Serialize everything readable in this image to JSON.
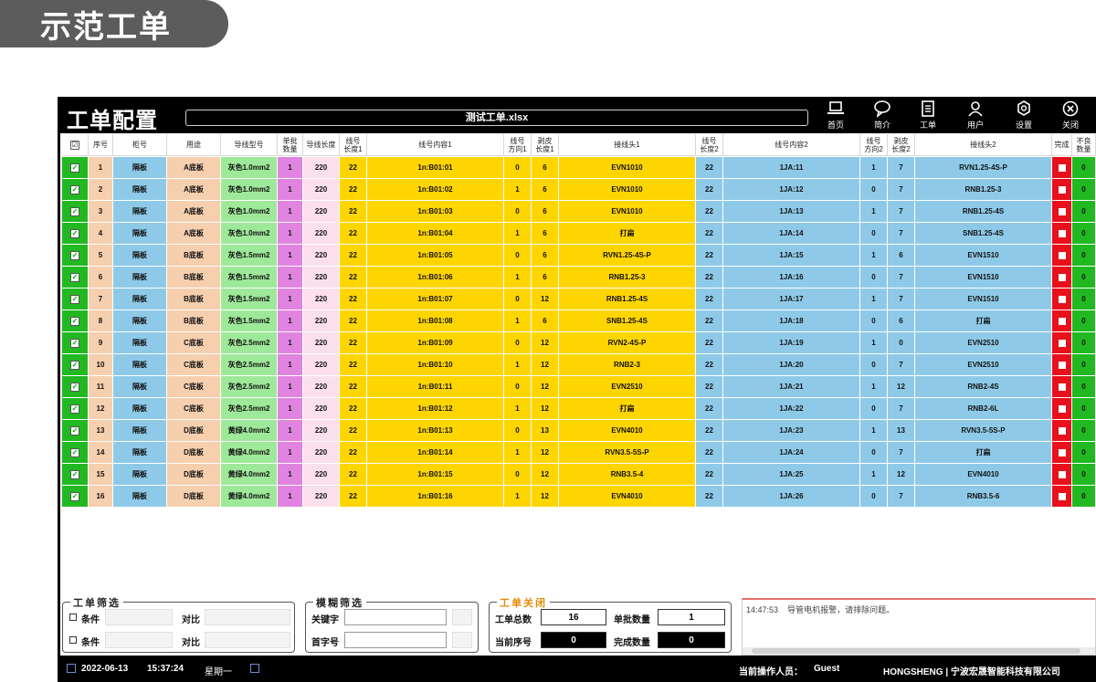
{
  "banner": "示范工单",
  "window": {
    "title": "工单配置",
    "filename": "测试工单.xlsx",
    "nav": [
      {
        "label": "首页",
        "icon": "laptop-icon"
      },
      {
        "label": "简介",
        "icon": "chat-bubble-icon"
      },
      {
        "label": "工单",
        "icon": "document-icon"
      },
      {
        "label": "用户",
        "icon": "user-icon"
      },
      {
        "label": "设置",
        "icon": "gear-icon"
      },
      {
        "label": "关闭",
        "icon": "close-icon"
      }
    ]
  },
  "table": {
    "headers": [
      "☑",
      "序号",
      "柜号",
      "用途",
      "导线型号",
      "单批\n数量",
      "导线长度",
      "线号\n长度1",
      "线号内容1",
      "线号\n方向1",
      "剥皮\n长度1",
      "接线头1",
      "线号\n长度2",
      "线号内容2",
      "线号\n方向2",
      "剥皮\n长度2",
      "接线头2",
      "完成",
      "不良\n数量"
    ],
    "colors": {
      "check": "#22b822",
      "seq": "#f6cfae",
      "cabinet": "#8ecae8",
      "use": "#f6cfae",
      "wire": "#9ee89a",
      "batch": "#e084e0",
      "length": "#fbe0ec",
      "yellow": "#ffd500",
      "blue": "#8ecae8",
      "done": "#e8101a",
      "bad": "#22b822"
    },
    "rows": [
      {
        "seq": "1",
        "cabinet": "隔板",
        "use": "A底板",
        "wire": "灰色1.0mm2",
        "batch": "1",
        "length": "220",
        "len1": "22",
        "content1": "1n:B01:01",
        "dir1": "0",
        "strip1": "6",
        "term1": "EVN1010",
        "len2": "22",
        "content2": "1JA:11",
        "dir2": "1",
        "strip2": "7",
        "term2": "RVN1.25-4S-P",
        "bad": "0"
      },
      {
        "seq": "2",
        "cabinet": "隔板",
        "use": "A底板",
        "wire": "灰色1.0mm2",
        "batch": "1",
        "length": "220",
        "len1": "22",
        "content1": "1n:B01:02",
        "dir1": "1",
        "strip1": "6",
        "term1": "EVN1010",
        "len2": "22",
        "content2": "1JA:12",
        "dir2": "0",
        "strip2": "7",
        "term2": "RNB1.25-3",
        "bad": "0"
      },
      {
        "seq": "3",
        "cabinet": "隔板",
        "use": "A底板",
        "wire": "灰色1.0mm2",
        "batch": "1",
        "length": "220",
        "len1": "22",
        "content1": "1n:B01:03",
        "dir1": "0",
        "strip1": "6",
        "term1": "EVN1010",
        "len2": "22",
        "content2": "1JA:13",
        "dir2": "1",
        "strip2": "7",
        "term2": "RNB1.25-4S",
        "bad": "0"
      },
      {
        "seq": "4",
        "cabinet": "隔板",
        "use": "A底板",
        "wire": "灰色1.0mm2",
        "batch": "1",
        "length": "220",
        "len1": "22",
        "content1": "1n:B01:04",
        "dir1": "1",
        "strip1": "6",
        "term1": "打扁",
        "len2": "22",
        "content2": "1JA:14",
        "dir2": "0",
        "strip2": "7",
        "term2": "SNB1.25-4S",
        "bad": "0"
      },
      {
        "seq": "5",
        "cabinet": "隔板",
        "use": "B底板",
        "wire": "灰色1.5mm2",
        "batch": "1",
        "length": "220",
        "len1": "22",
        "content1": "1n:B01:05",
        "dir1": "0",
        "strip1": "6",
        "term1": "RVN1.25-4S-P",
        "len2": "22",
        "content2": "1JA:15",
        "dir2": "1",
        "strip2": "6",
        "term2": "EVN1510",
        "bad": "0"
      },
      {
        "seq": "6",
        "cabinet": "隔板",
        "use": "B底板",
        "wire": "灰色1.5mm2",
        "batch": "1",
        "length": "220",
        "len1": "22",
        "content1": "1n:B01:06",
        "dir1": "1",
        "strip1": "6",
        "term1": "RNB1.25-3",
        "len2": "22",
        "content2": "1JA:16",
        "dir2": "0",
        "strip2": "7",
        "term2": "EVN1510",
        "bad": "0"
      },
      {
        "seq": "7",
        "cabinet": "隔板",
        "use": "B底板",
        "wire": "灰色1.5mm2",
        "batch": "1",
        "length": "220",
        "len1": "22",
        "content1": "1n:B01:07",
        "dir1": "0",
        "strip1": "12",
        "term1": "RNB1.25-4S",
        "len2": "22",
        "content2": "1JA:17",
        "dir2": "1",
        "strip2": "7",
        "term2": "EVN1510",
        "bad": "0"
      },
      {
        "seq": "8",
        "cabinet": "隔板",
        "use": "B底板",
        "wire": "灰色1.5mm2",
        "batch": "1",
        "length": "220",
        "len1": "22",
        "content1": "1n:B01:08",
        "dir1": "1",
        "strip1": "6",
        "term1": "SNB1.25-4S",
        "len2": "22",
        "content2": "1JA:18",
        "dir2": "0",
        "strip2": "6",
        "term2": "打扁",
        "bad": "0"
      },
      {
        "seq": "9",
        "cabinet": "隔板",
        "use": "C底板",
        "wire": "灰色2.5mm2",
        "batch": "1",
        "length": "220",
        "len1": "22",
        "content1": "1n:B01:09",
        "dir1": "0",
        "strip1": "12",
        "term1": "RVN2-4S-P",
        "len2": "22",
        "content2": "1JA:19",
        "dir2": "1",
        "strip2": "0",
        "term2": "EVN2510",
        "bad": "0"
      },
      {
        "seq": "10",
        "cabinet": "隔板",
        "use": "C底板",
        "wire": "灰色2.5mm2",
        "batch": "1",
        "length": "220",
        "len1": "22",
        "content1": "1n:B01:10",
        "dir1": "1",
        "strip1": "12",
        "term1": "RNB2-3",
        "len2": "22",
        "content2": "1JA:20",
        "dir2": "0",
        "strip2": "7",
        "term2": "EVN2510",
        "bad": "0"
      },
      {
        "seq": "11",
        "cabinet": "隔板",
        "use": "C底板",
        "wire": "灰色2.5mm2",
        "batch": "1",
        "length": "220",
        "len1": "22",
        "content1": "1n:B01:11",
        "dir1": "0",
        "strip1": "12",
        "term1": "EVN2510",
        "len2": "22",
        "content2": "1JA:21",
        "dir2": "1",
        "strip2": "12",
        "term2": "RNB2-4S",
        "bad": "0"
      },
      {
        "seq": "12",
        "cabinet": "隔板",
        "use": "C底板",
        "wire": "灰色2.5mm2",
        "batch": "1",
        "length": "220",
        "len1": "22",
        "content1": "1n:B01:12",
        "dir1": "1",
        "strip1": "12",
        "term1": "打扁",
        "len2": "22",
        "content2": "1JA:22",
        "dir2": "0",
        "strip2": "7",
        "term2": "RNB2-6L",
        "bad": "0"
      },
      {
        "seq": "13",
        "cabinet": "隔板",
        "use": "D底板",
        "wire": "黄绿4.0mm2",
        "batch": "1",
        "length": "220",
        "len1": "22",
        "content1": "1n:B01:13",
        "dir1": "0",
        "strip1": "13",
        "term1": "EVN4010",
        "len2": "22",
        "content2": "1JA:23",
        "dir2": "1",
        "strip2": "13",
        "term2": "RVN3.5-5S-P",
        "bad": "0"
      },
      {
        "seq": "14",
        "cabinet": "隔板",
        "use": "D底板",
        "wire": "黄绿4.0mm2",
        "batch": "1",
        "length": "220",
        "len1": "22",
        "content1": "1n:B01:14",
        "dir1": "1",
        "strip1": "12",
        "term1": "RVN3.5-5S-P",
        "len2": "22",
        "content2": "1JA:24",
        "dir2": "0",
        "strip2": "7",
        "term2": "打扁",
        "bad": "0"
      },
      {
        "seq": "15",
        "cabinet": "隔板",
        "use": "D底板",
        "wire": "黄绿4.0mm2",
        "batch": "1",
        "length": "220",
        "len1": "22",
        "content1": "1n:B01:15",
        "dir1": "0",
        "strip1": "12",
        "term1": "RNB3.5-4",
        "len2": "22",
        "content2": "1JA:25",
        "dir2": "1",
        "strip2": "12",
        "term2": "EVN4010",
        "bad": "0"
      },
      {
        "seq": "16",
        "cabinet": "隔板",
        "use": "D底板",
        "wire": "黄绿4.0mm2",
        "batch": "1",
        "length": "220",
        "len1": "22",
        "content1": "1n:B01:16",
        "dir1": "1",
        "strip1": "12",
        "term1": "EVN4010",
        "len2": "22",
        "content2": "1JA:26",
        "dir2": "0",
        "strip2": "7",
        "term2": "RNB3.5-6",
        "bad": "0"
      }
    ]
  },
  "filter": {
    "legend": "工单筛选",
    "rows": [
      {
        "cond": "条件",
        "cmp": "对比"
      },
      {
        "cond": "条件",
        "cmp": "对比"
      }
    ]
  },
  "fuzzy": {
    "legend": "模糊筛选",
    "keyword": "关键字",
    "initial": "首字号"
  },
  "close_panel": {
    "legend": "工单关闭",
    "total_label": "工单总数",
    "total": "16",
    "batch_label": "单批数量",
    "batch": "1",
    "current_label": "当前序号",
    "current": "0",
    "done_label": "完成数量",
    "done": "0"
  },
  "log": {
    "time": "14:47:53",
    "message": "导管电机报警，请排除问题。"
  },
  "status": {
    "date": "2022-06-13",
    "time": "15:37:24",
    "weekday": "星期一",
    "operator_label": "当前操作人员：",
    "operator": "Guest",
    "company": "HONGSHENG | 宁波宏晟智能科技有限公司"
  }
}
